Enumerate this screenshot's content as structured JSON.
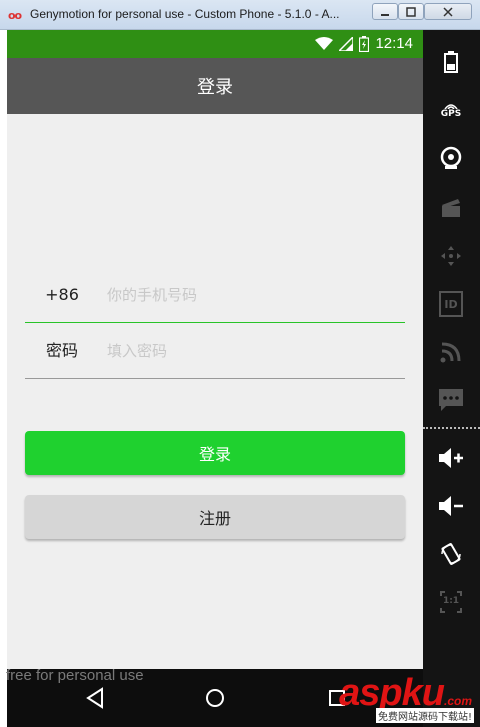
{
  "window": {
    "title": "Genymotion for personal use - Custom Phone - 5.1.0 - A...",
    "icon": "genymotion-icon",
    "controls": [
      "minimize",
      "maximize",
      "close"
    ]
  },
  "status_bar": {
    "time": "12:14",
    "color": "#2f8f14",
    "icons": [
      "wifi-icon",
      "signal-icon",
      "battery-icon"
    ]
  },
  "action_bar": {
    "title": "登录",
    "color": "#565656"
  },
  "form": {
    "phone": {
      "label": "+86",
      "placeholder": "你的手机号码",
      "value": ""
    },
    "password": {
      "label": "密码",
      "placeholder": "填入密码",
      "value": ""
    }
  },
  "buttons": {
    "login": {
      "label": "登录",
      "color": "#1fd12f"
    },
    "register": {
      "label": "注册",
      "color": "#d6d6d6"
    }
  },
  "nav_bar": {
    "icons": [
      "back-icon",
      "home-icon",
      "recent-apps-icon"
    ]
  },
  "side_panel": {
    "gps_label": "GPS",
    "id_label": "ID",
    "scale_label": "1:1",
    "icons": [
      "battery-widget-icon",
      "gps-icon",
      "camera-icon",
      "capture-icon",
      "dpad-icon",
      "id-icon",
      "network-icon",
      "sms-icon",
      "volume-up-icon",
      "volume-down-icon",
      "rotate-icon",
      "pixel-perfect-icon"
    ]
  },
  "watermark": {
    "text": "free for personal use"
  },
  "brand": {
    "text": "aspku",
    "tld": ".com",
    "subtitle": "免费网站源码下载站!"
  }
}
